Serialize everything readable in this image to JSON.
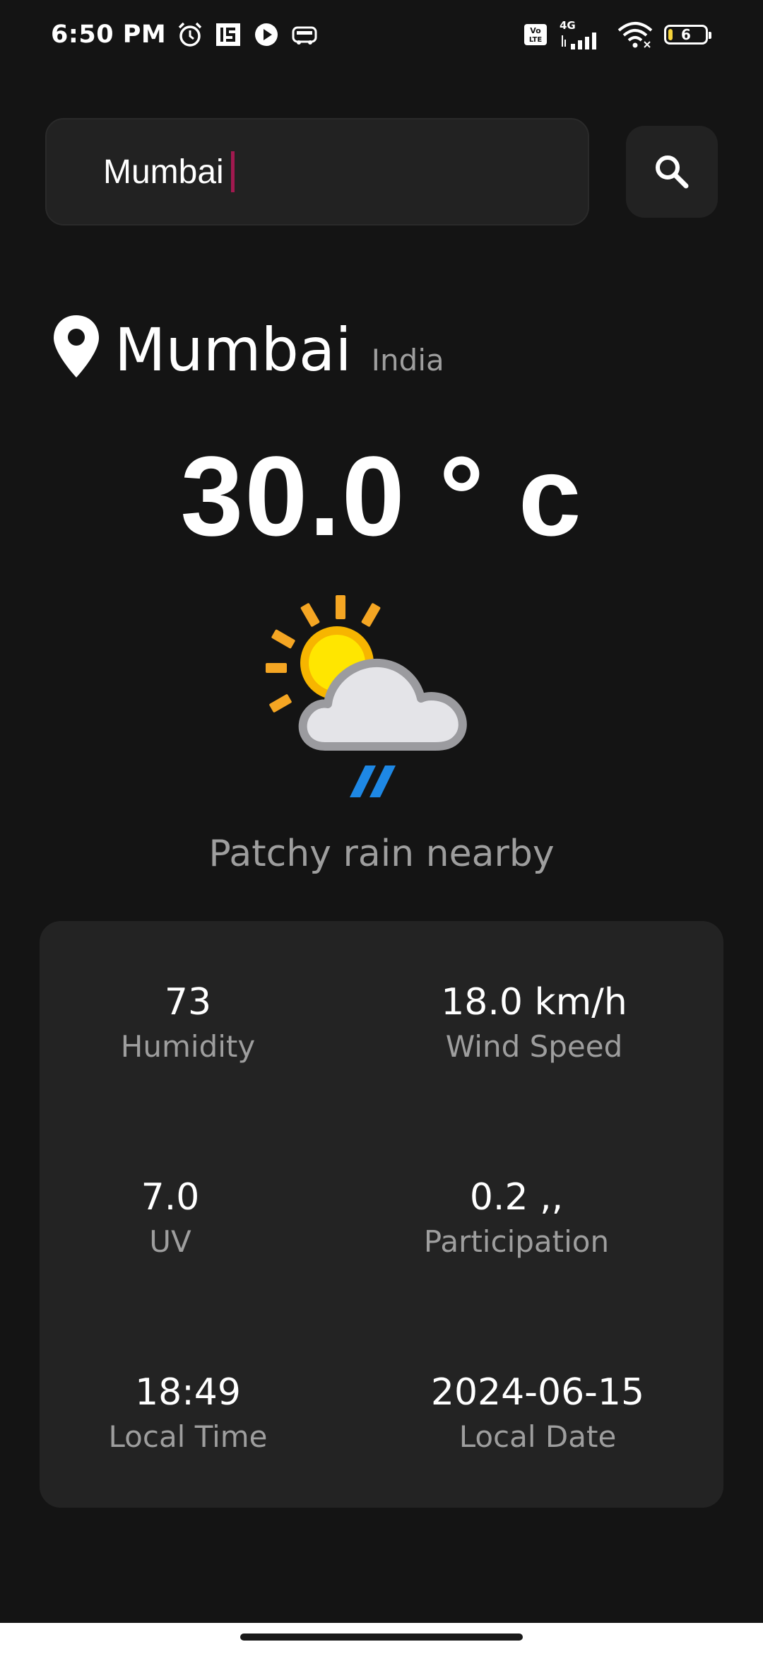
{
  "status_bar": {
    "time": "6:50 PM",
    "network_label": "4G",
    "volte_label": "Vo LTE",
    "battery_level": "6",
    "icons": [
      "alarm-icon",
      "is-app-icon",
      "play-icon",
      "redbus-icon",
      "volte-icon",
      "signal-icon",
      "wifi-icon",
      "battery-icon"
    ]
  },
  "search": {
    "value": "Mumbai",
    "icon": "search-icon"
  },
  "location": {
    "icon": "location-pin-icon",
    "city": "Mumbai",
    "country": "India"
  },
  "current": {
    "temperature": "30.0 ° c",
    "condition": "Patchy rain nearby",
    "condition_icon": "sun-cloud-rain-icon"
  },
  "stats": {
    "humidity": {
      "value": "73",
      "label": "Humidity"
    },
    "wind_speed": {
      "value": "18.0 km/h",
      "label": "Wind Speed"
    },
    "uv": {
      "value": "7.0",
      "label": "UV"
    },
    "precipitation": {
      "value": "0.2 ,,",
      "label": "Participation"
    },
    "local_time": {
      "value": "18:49",
      "label": "Local Time"
    },
    "local_date": {
      "value": "2024-06-15",
      "label": "Local Date"
    }
  },
  "colors": {
    "background": "#141414",
    "card": "#232323",
    "muted_text": "#9e9e9e",
    "caret": "#c2185b"
  }
}
